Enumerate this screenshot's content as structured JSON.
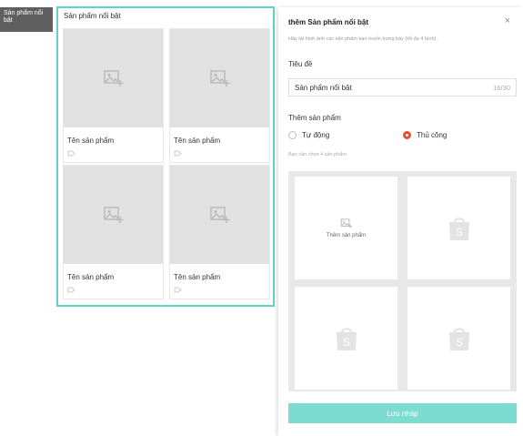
{
  "side_label": "Sản phẩm nổi bật",
  "preview": {
    "title": "Sản phẩm nổi bật",
    "cards": [
      {
        "name": "Tên sản phẩm",
        "price_icon": "price-tag-icon"
      },
      {
        "name": "Tên sản phẩm",
        "price_icon": "price-tag-icon"
      },
      {
        "name": "Tên sản phẩm",
        "price_icon": "price-tag-icon"
      },
      {
        "name": "Tên sản phẩm",
        "price_icon": "price-tag-icon"
      }
    ]
  },
  "panel": {
    "title": "thêm Sản phẩm nổi bật",
    "close": "×",
    "hint": "Hãy tải hình ảnh các sản phẩm bạn muốn trưng bày (tối đa 4 hình).",
    "title_label": "Tiêu đề",
    "title_value": "Sản phẩm nổi bật",
    "title_count": "16/30",
    "products_label": "Thêm sản phẩm",
    "option_auto": "Tự động",
    "option_manual": "Thủ công",
    "selected_option": "Thủ công",
    "note": "Bạn cần chọn 4 sản phẩm",
    "add_product_label": "Thêm sản phẩm",
    "save_label": "Lưu nháp"
  },
  "colors": {
    "accent": "#5fd3c6",
    "save_button": "#7ddcd2",
    "radio_active": "#ee4d2d",
    "placeholder": "#e1e1e1"
  }
}
